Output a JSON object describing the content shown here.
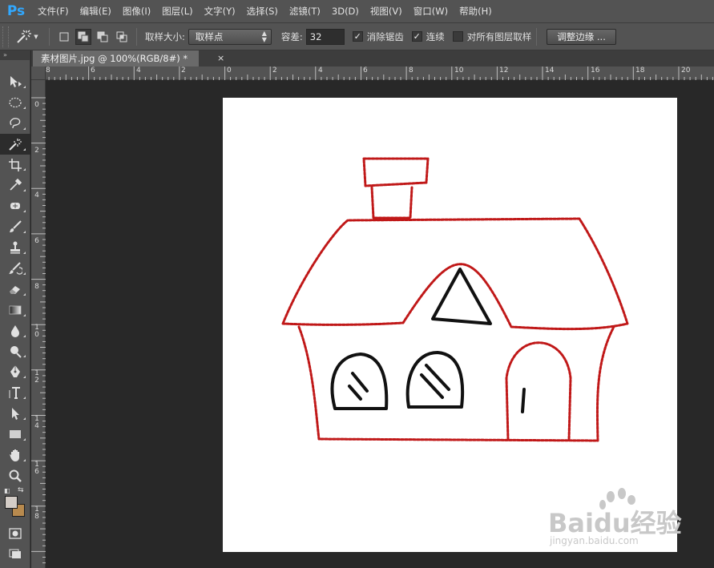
{
  "app": {
    "logo": "Ps",
    "menu": [
      "文件(F)",
      "编辑(E)",
      "图像(I)",
      "图层(L)",
      "文字(Y)",
      "选择(S)",
      "滤镜(T)",
      "3D(D)",
      "视图(V)",
      "窗口(W)",
      "帮助(H)"
    ]
  },
  "options": {
    "tool_icon": "magic-wand-icon",
    "sample_size_label": "取样大小:",
    "sample_size_value": "取样点",
    "tolerance_label": "容差:",
    "tolerance_value": "32",
    "anti_alias_label": "消除锯齿",
    "anti_alias_checked": true,
    "contiguous_label": "连续",
    "contiguous_checked": true,
    "sample_all_label": "对所有图层取样",
    "sample_all_checked": false,
    "refine_edge_label": "调整边缘 ..."
  },
  "toolbar": {
    "header": "»",
    "tools": [
      "move-icon",
      "elliptical-marquee-icon",
      "lasso-icon",
      "magic-wand-icon",
      "crop-icon",
      "eyedropper-icon",
      "spot-healing-icon",
      "brush-icon",
      "clone-stamp-icon",
      "history-brush-icon",
      "eraser-icon",
      "gradient-icon",
      "blur-icon",
      "dodge-icon",
      "pen-icon",
      "type-icon",
      "path-selection-icon",
      "rectangle-icon",
      "hand-icon",
      "zoom-icon"
    ],
    "active_tool": "magic-wand-icon",
    "foreground_color": "#d4cdc7",
    "background_color": "#b88a4e"
  },
  "document": {
    "tab_title": "素材图片.jpg @ 100%(RGB/8#) *",
    "close_glyph": "×"
  },
  "rulers": {
    "top_labels": [
      "8",
      "6",
      "4",
      "2",
      "0",
      "2",
      "4",
      "6",
      "8",
      "10",
      "12",
      "14",
      "16",
      "18",
      "20"
    ],
    "left_labels": [
      "0",
      "2",
      "4",
      "6",
      "8",
      "10",
      "12",
      "14",
      "16",
      "18"
    ]
  },
  "watermark": {
    "main": "Baidu经验",
    "sub": "jingyan.baidu.com"
  },
  "colors": {
    "selection_outline": "#c01818",
    "drawing_ink": "#111111",
    "ui_panel": "#535353",
    "workspace": "#282828"
  }
}
